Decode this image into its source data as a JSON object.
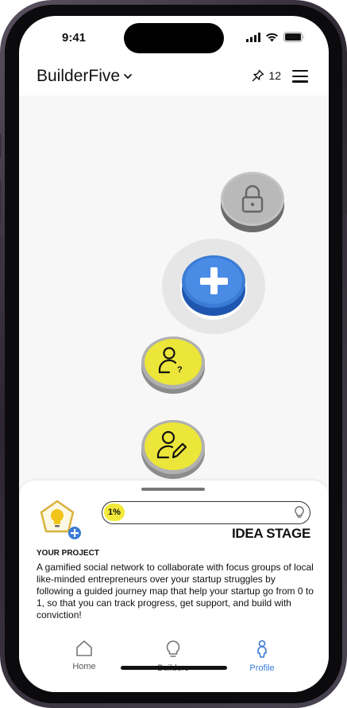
{
  "status_bar": {
    "time": "9:41"
  },
  "header": {
    "app_name": "BuilderFive",
    "pin_count": "12"
  },
  "map": {
    "nodes": [
      {
        "state": "locked",
        "icon": "lock-icon"
      },
      {
        "state": "current",
        "icon": "plus-icon"
      },
      {
        "state": "completed",
        "icon": "person-question-icon"
      },
      {
        "state": "completed",
        "icon": "person-edit-icon"
      }
    ]
  },
  "project": {
    "progress_label": "1%",
    "progress": 0.01,
    "stage": "IDEA STAGE",
    "heading": "YOUR PROJECT",
    "description": "A gamified social network to collaborate with focus groups of local like-minded entrepreneurs over your startup struggles by following a guided journey map that help your startup go from 0 to 1, so that you can track progress, get support, and build with conviction!"
  },
  "tabs": [
    {
      "label": "Home",
      "icon": "home-icon",
      "active": false
    },
    {
      "label": "Builders",
      "icon": "lightbulb-icon",
      "active": false
    },
    {
      "label": "Profile",
      "icon": "profile-icon",
      "active": true
    }
  ],
  "colors": {
    "accent": "#3a7bd5",
    "yellow": "#f2e93a",
    "locked": "#bdbdbd"
  }
}
